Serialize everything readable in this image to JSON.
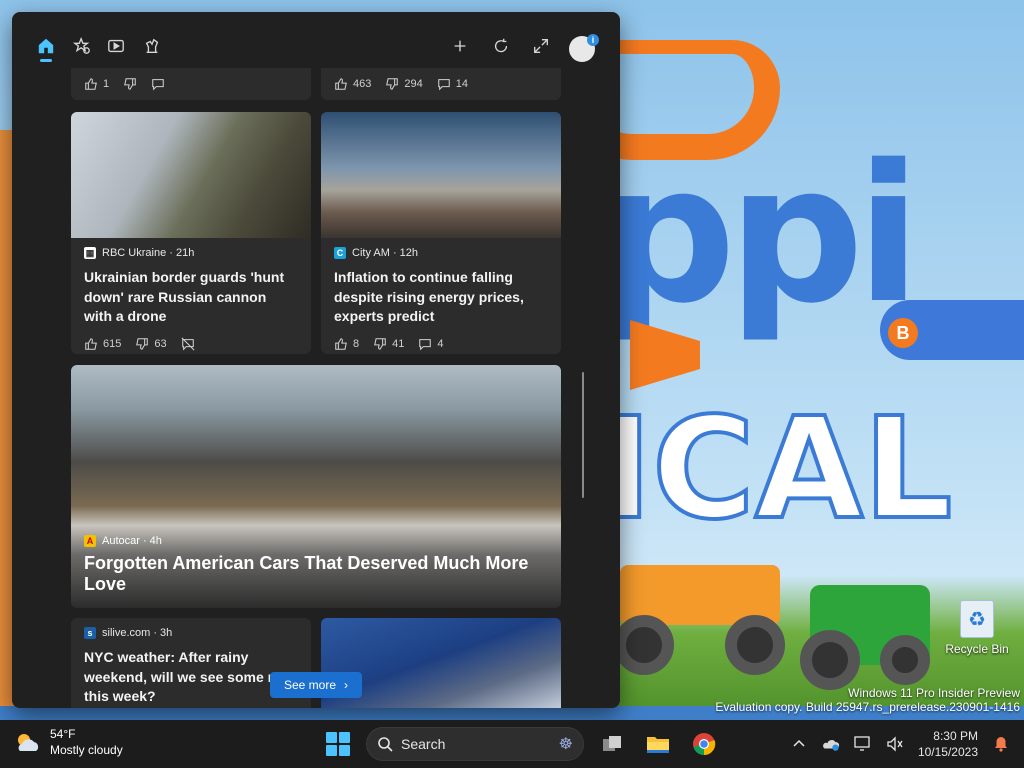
{
  "desktop": {
    "recycle_bin_label": "Recycle Bin",
    "watermark_line1": "Windows 11 Pro Insider Preview",
    "watermark_line2": "Evaluation copy. Build 25947.rs_prerelease.230901-1416"
  },
  "widgets": {
    "topbar": {
      "icons": [
        "home-icon",
        "star-icon",
        "play-icon",
        "chess-icon",
        "add-icon",
        "refresh-icon",
        "expand-icon",
        "avatar"
      ],
      "avatar_badge": "i"
    },
    "cards": [
      {
        "actions": {
          "likes": "1"
        }
      },
      {
        "actions": {
          "likes": "463",
          "dislikes": "294",
          "comments": "14"
        }
      },
      {
        "source": "RBC Ukraine · 21h",
        "headline": "Ukrainian border guards 'hunt down' rare Russian cannon with a drone",
        "actions": {
          "likes": "615",
          "dislikes": "63"
        }
      },
      {
        "source": "City AM · 12h",
        "headline": "Inflation to continue falling despite rising energy prices, experts predict",
        "actions": {
          "likes": "8",
          "dislikes": "41",
          "comments": "4"
        }
      },
      {
        "source": "Autocar · 4h",
        "headline": "Forgotten American Cars That Deserved Much More Love"
      },
      {
        "source": "silive.com · 3h",
        "headline": "NYC weather: After rainy weekend, will we see some r this week?"
      }
    ],
    "see_more_label": "See more"
  },
  "taskbar": {
    "weather_temp": "54°F",
    "weather_condition": "Mostly cloudy",
    "search_placeholder": "Search",
    "time": "8:30 PM",
    "date": "10/15/2023"
  },
  "colors": {
    "accent": "#4cc2ff",
    "panel_bg": "#202020",
    "card_bg": "#2c2c2c",
    "see_more_bg": "#1a6fcf"
  }
}
